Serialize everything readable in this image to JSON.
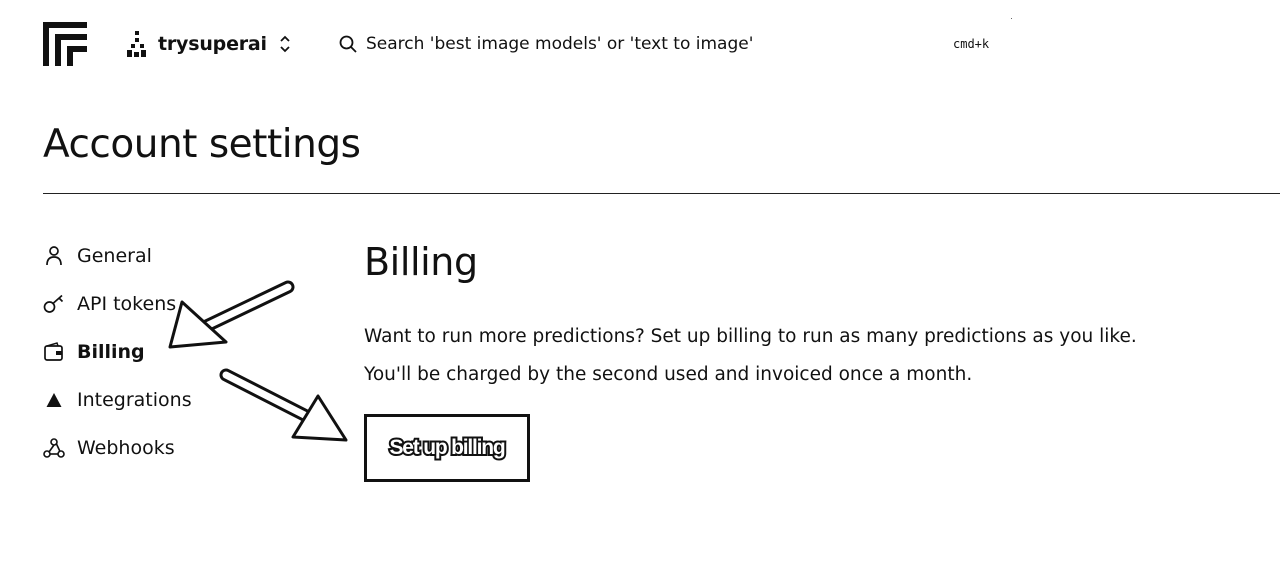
{
  "header": {
    "org_name": "trysuperai",
    "search_placeholder": "Search 'best image models' or 'text to image'",
    "search_shortcut": "cmd+k"
  },
  "page": {
    "title": "Account settings"
  },
  "sidebar": {
    "items": [
      {
        "label": "General",
        "icon": "user-icon",
        "active": false
      },
      {
        "label": "API tokens",
        "icon": "key-icon",
        "active": false
      },
      {
        "label": "Billing",
        "icon": "wallet-icon",
        "active": true
      },
      {
        "label": "Integrations",
        "icon": "triangle-icon",
        "active": false
      },
      {
        "label": "Webhooks",
        "icon": "webhook-icon",
        "active": false
      }
    ]
  },
  "billing": {
    "title": "Billing",
    "description_lines": [
      "Want to run more predictions? Set up billing to run as many predictions as you like.",
      "You'll be charged by the second used and invoiced once a month."
    ],
    "cta_label": "Set up billing"
  },
  "colors": {
    "text": "#111111",
    "background": "#ffffff",
    "accent": "#111111"
  }
}
